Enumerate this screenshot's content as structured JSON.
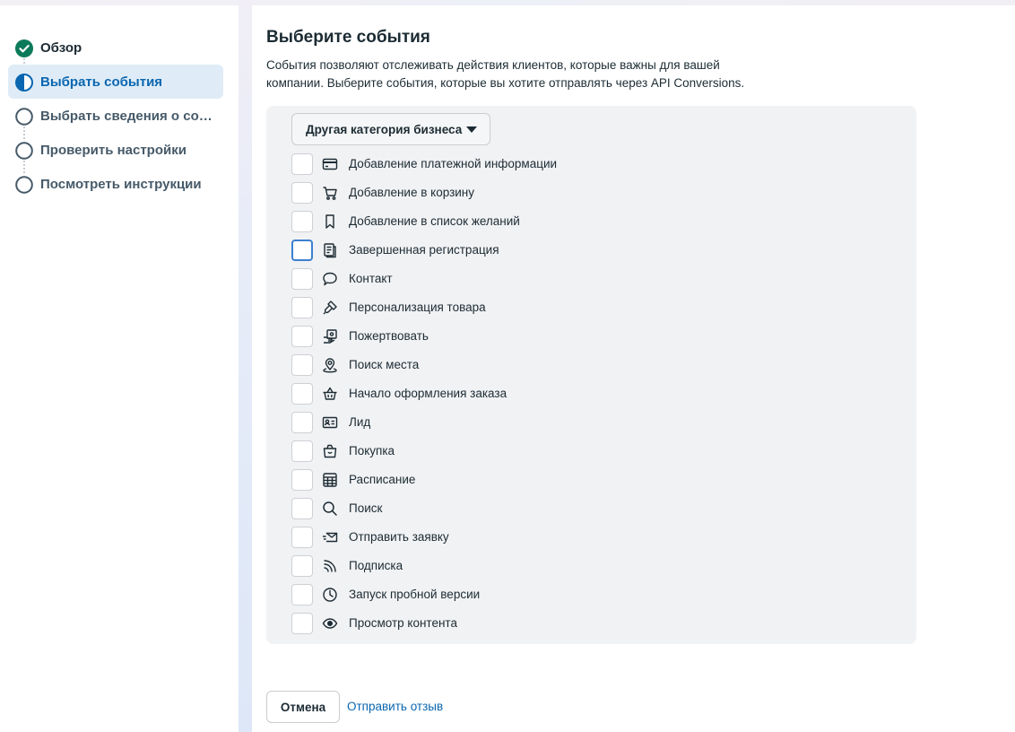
{
  "sidebar": {
    "steps": [
      {
        "label": "Обзор",
        "state": "done",
        "icon": "check-circle-icon"
      },
      {
        "label": "Выбрать события",
        "state": "active",
        "icon": "half-circle-icon"
      },
      {
        "label": "Выбрать сведения о событиях",
        "state": "pending",
        "icon": "empty-circle-icon"
      },
      {
        "label": "Проверить настройки",
        "state": "pending",
        "icon": "empty-circle-icon"
      },
      {
        "label": "Посмотреть инструкции",
        "state": "pending",
        "icon": "empty-circle-icon"
      }
    ]
  },
  "main": {
    "title": "Выберите события",
    "description": "События позволяют отслеживать действия клиентов, которые важны для вашей компании. Выберите события, которые вы хотите отправлять через API Conversions.",
    "category_dropdown": {
      "value": "Другая категория бизнеса"
    },
    "events": [
      {
        "label": "Добавление платежной информации",
        "icon": "credit-card-icon",
        "checked": false
      },
      {
        "label": "Добавление в корзину",
        "icon": "cart-icon",
        "checked": false
      },
      {
        "label": "Добавление в список желаний",
        "icon": "bookmark-icon",
        "checked": false
      },
      {
        "label": "Завершенная регистрация",
        "icon": "registration-form-icon",
        "checked": false,
        "focused": true
      },
      {
        "label": "Контакт",
        "icon": "chat-bubble-icon",
        "checked": false
      },
      {
        "label": "Персонализация товара",
        "icon": "paintbrush-icon",
        "checked": false
      },
      {
        "label": "Пожертвовать",
        "icon": "donate-icon",
        "checked": false
      },
      {
        "label": "Поиск места",
        "icon": "location-pin-icon",
        "checked": false
      },
      {
        "label": "Начало оформления заказа",
        "icon": "basket-icon",
        "checked": false
      },
      {
        "label": "Лид",
        "icon": "contact-card-icon",
        "checked": false
      },
      {
        "label": "Покупка",
        "icon": "shopping-bag-icon",
        "checked": false
      },
      {
        "label": "Расписание",
        "icon": "calendar-grid-icon",
        "checked": false
      },
      {
        "label": "Поиск",
        "icon": "search-icon",
        "checked": false
      },
      {
        "label": "Отправить заявку",
        "icon": "send-envelope-icon",
        "checked": false
      },
      {
        "label": "Подписка",
        "icon": "rss-icon",
        "checked": false
      },
      {
        "label": "Запуск пробной версии",
        "icon": "clock-icon",
        "checked": false
      },
      {
        "label": "Просмотр контента",
        "icon": "eye-icon",
        "checked": false
      }
    ]
  },
  "footer": {
    "cancel_label": "Отмена",
    "feedback_label": "Отправить отзыв"
  },
  "colors": {
    "accent": "#0a66b0",
    "done_green": "#0b7a5a",
    "active_bg": "#dfecf7",
    "panel_bg": "#f1f2f4"
  }
}
